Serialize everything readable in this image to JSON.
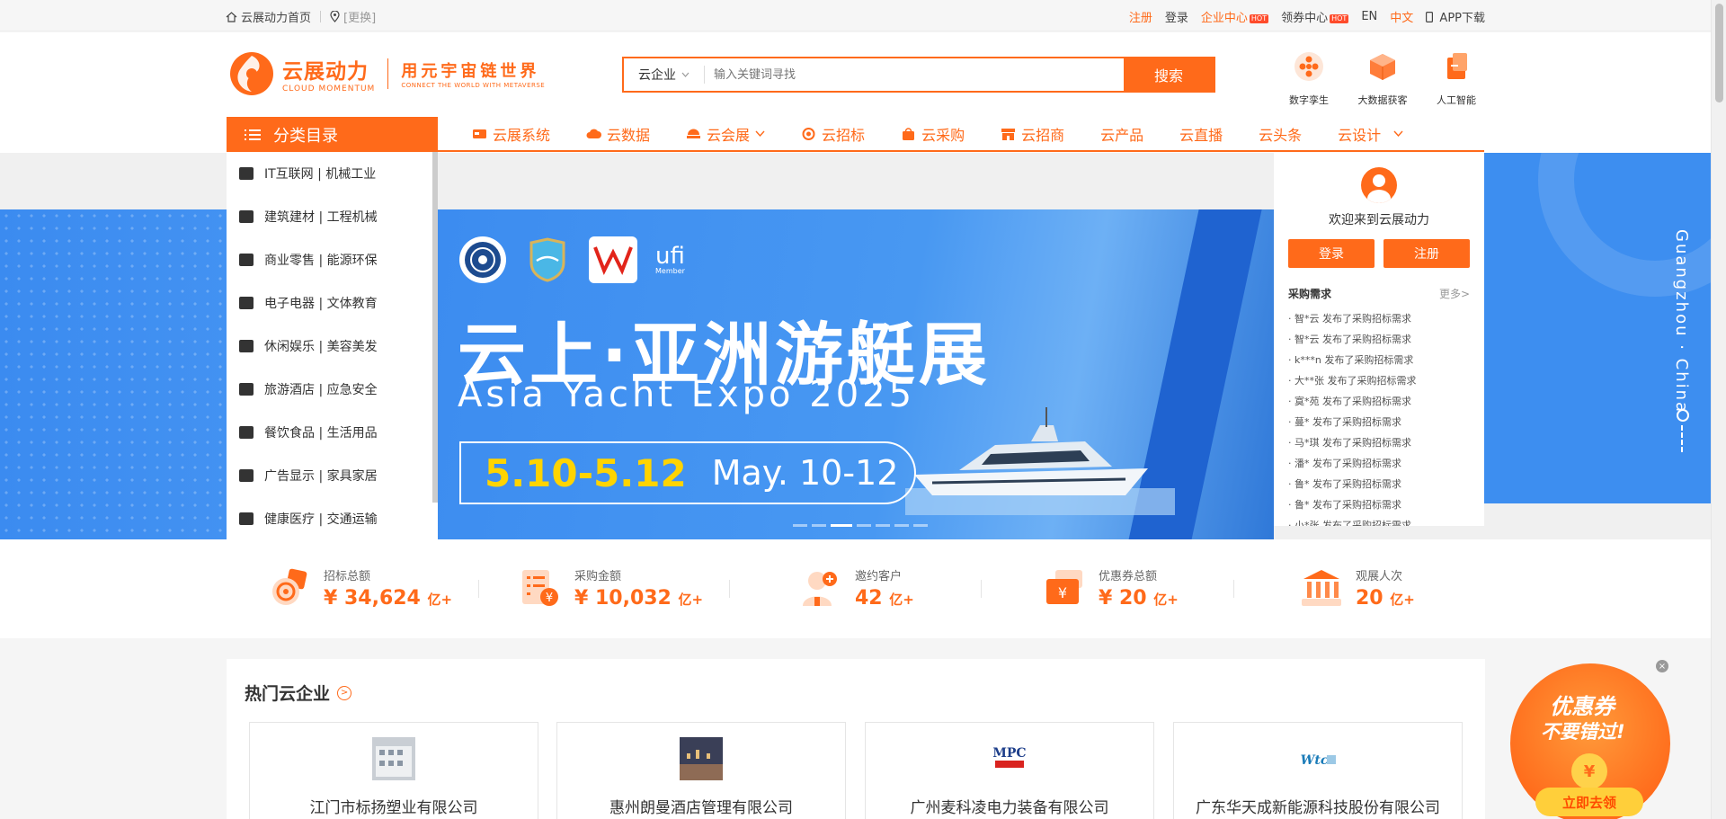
{
  "topbar": {
    "home": "云展动力首页",
    "location_switch": "[更换]",
    "register": "注册",
    "login": "登录",
    "enterprise_center": "企业中心",
    "coupon_center": "领券中心",
    "hot_badge": "HOT",
    "lang_en": "EN",
    "lang_cn": "中文",
    "app_download": "APP下载"
  },
  "logo": {
    "cn": "云展动力",
    "en": "CLOUD MOMENTUM",
    "slogan_cn": "用元宇宙链世界",
    "slogan_en": "CONNECT THE WORLD WITH METAVERSE"
  },
  "search": {
    "scope": "云企业",
    "placeholder": "输入关键词寻找",
    "button": "搜索"
  },
  "quick_links": [
    {
      "label": "数字孪生",
      "icon": "digital-twin-icon"
    },
    {
      "label": "大数据获客",
      "icon": "big-data-icon"
    },
    {
      "label": "人工智能",
      "icon": "ai-icon"
    }
  ],
  "category_button": "分类目录",
  "nav": [
    {
      "label": "云展系统",
      "icon": "exhibition-system-icon"
    },
    {
      "label": "云数据",
      "icon": "cloud-data-icon"
    },
    {
      "label": "云会展",
      "icon": "cloud-exhibition-icon",
      "dropdown": true
    },
    {
      "label": "云招标",
      "icon": "bidding-icon"
    },
    {
      "label": "云采购",
      "icon": "purchase-icon"
    },
    {
      "label": "云招商",
      "icon": "investment-icon"
    },
    {
      "label": "云产品"
    },
    {
      "label": "云直播"
    },
    {
      "label": "云头条"
    },
    {
      "label": "云设计",
      "dropdown": true
    }
  ],
  "categories": [
    "IT互联网 | 机械工业",
    "建筑建材 | 工程机械",
    "商业零售 | 能源环保",
    "电子电器 | 文体教育",
    "休闲娱乐 | 美容美发",
    "旅游酒店 | 应急安全",
    "餐饮食品 | 生活用品",
    "广告显示 | 家具家居",
    "健康医疗 | 交通运输"
  ],
  "banner": {
    "title": "云上·亚洲游艇展",
    "subtitle": "Asia Yacht Expo 2025",
    "date_cn": "5.10-5.12",
    "date_en": "May. 10-12",
    "logo_text": "ufi",
    "logo_sub": "Member",
    "side_city": "Guangzhou · China",
    "slides": 7,
    "active_slide": 3
  },
  "panel": {
    "welcome": "欢迎来到云展动力",
    "login": "登录",
    "register": "注册",
    "section_title": "采购需求",
    "more": "更多>",
    "items": [
      "· 智*云  发布了采购招标需求",
      "· 智*云  发布了采购招标需求",
      "· k***n  发布了采购招标需求",
      "· 大**张  发布了采购招标需求",
      "· 寞*苑  发布了采购招标需求",
      "· 蔓*  发布了采购招标需求",
      "· 马*琪  发布了采购招标需求",
      "· 潘*  发布了采购招标需求",
      "· 鲁*  发布了采购招标需求",
      "· 鲁*  发布了采购招标需求",
      "· 小*张  发布了采购招标需求"
    ]
  },
  "stats": [
    {
      "label": "招标总额",
      "value": "¥ 34,624",
      "unit": "亿+"
    },
    {
      "label": "采购金额",
      "value": "¥ 10,032",
      "unit": "亿+"
    },
    {
      "label": "邀约客户",
      "value": "42",
      "unit": "亿+"
    },
    {
      "label": "优惠券总额",
      "value": "¥ 20",
      "unit": "亿+"
    },
    {
      "label": "观展人次",
      "value": "20",
      "unit": "亿+"
    }
  ],
  "hot_section": {
    "title": "热门云企业",
    "companies": [
      "江门市标扬塑业有限公司",
      "惠州朗曼酒店管理有限公司",
      "广州麦科凌电力装备有限公司",
      "广东华天成新能源科技股份有限公司"
    ]
  },
  "coupon": {
    "line1": "优惠券",
    "line2": "不要错过!",
    "symbol": "¥",
    "cta": "立即去领"
  },
  "colors": {
    "accent": "#ff6a1a",
    "banner_blue": "#3d8ef0",
    "date_yellow": "#ffd400"
  }
}
